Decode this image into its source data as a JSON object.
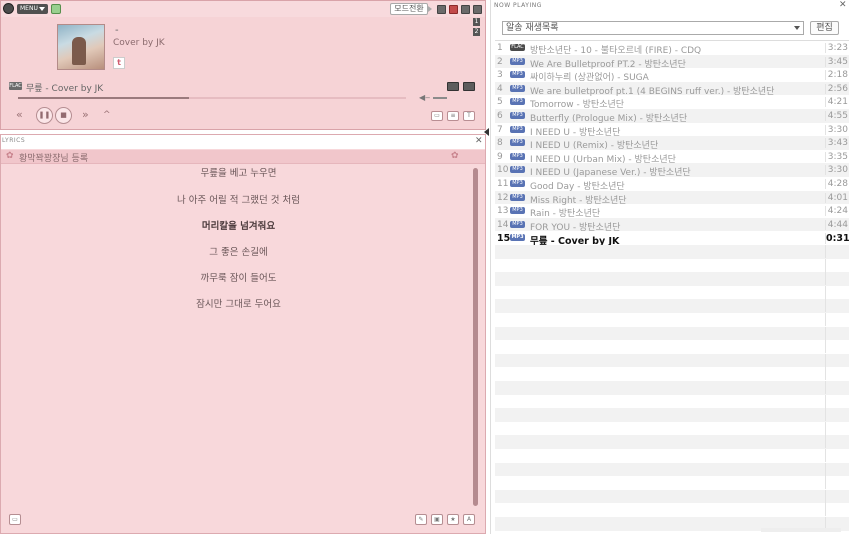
{
  "player": {
    "menu_label": "MENU",
    "mode_button": "모드전환",
    "song_title": "-",
    "song_artist": "Cover by JK",
    "sns_label": "t",
    "side_nums": [
      "1",
      "2"
    ],
    "format_badge": "FLAC",
    "now_playing_text": "무릎 - Cover by JK",
    "progress": 0.44,
    "controls": {
      "prev": "«",
      "pause": "❚❚",
      "stop": "■",
      "next": "»",
      "up": "^"
    }
  },
  "lyrics": {
    "header": "LYRICS",
    "credit": "황막꽉꽝쟝님 등록",
    "lines": [
      {
        "text": "무릎을 베고 누우면",
        "current": false
      },
      {
        "text": "나 아주 어릴 적 그랬던 것 처럼",
        "current": false
      },
      {
        "text": "머리칼을 넘겨줘요",
        "current": true
      },
      {
        "text": "그 좋은 손길에",
        "current": false
      },
      {
        "text": "까무룩 잠이 들어도",
        "current": false
      },
      {
        "text": "잠시만 그대로 두어요",
        "current": false
      }
    ]
  },
  "now_playing": {
    "header": "NOW PLAYING",
    "playlist_select": "알송 재생목록",
    "edit_label": "편집",
    "tracks": [
      {
        "no": "1",
        "badge": "FLAC",
        "title": "방탄소년단 - 10 - 불타오르네 (FIRE) - CDQ",
        "duration": "3:23"
      },
      {
        "no": "2",
        "badge": "MP3",
        "title": "We Are Bulletproof PT.2 - 방탄소년단",
        "duration": "3:45"
      },
      {
        "no": "3",
        "badge": "MP3",
        "title": "싸이하누릐 (상관없어) - SUGA",
        "duration": "2:18"
      },
      {
        "no": "4",
        "badge": "MP3",
        "title": "We are bulletproof pt.1 (4 BEGINS ruff ver.) - 방탄소년단",
        "duration": "2:56"
      },
      {
        "no": "5",
        "badge": "MP3",
        "title": "Tomorrow - 방탄소년단",
        "duration": "4:21"
      },
      {
        "no": "6",
        "badge": "MP3",
        "title": "Butterfly (Prologue Mix) - 방탄소년단",
        "duration": "4:55"
      },
      {
        "no": "7",
        "badge": "MP3",
        "title": "I NEED U - 방탄소년단",
        "duration": "3:30"
      },
      {
        "no": "8",
        "badge": "MP3",
        "title": "I NEED U (Remix) - 방탄소년단",
        "duration": "3:43"
      },
      {
        "no": "9",
        "badge": "MP3",
        "title": "I NEED U (Urban Mix) - 방탄소년단",
        "duration": "3:35"
      },
      {
        "no": "10",
        "badge": "MP3",
        "title": "I NEED U (Japanese Ver.) - 방탄소년단",
        "duration": "3:30"
      },
      {
        "no": "11",
        "badge": "MP3",
        "title": "Good Day - 방탄소년단",
        "duration": "4:28"
      },
      {
        "no": "12",
        "badge": "MP3",
        "title": "Miss Right - 방탄소년단",
        "duration": "4:01"
      },
      {
        "no": "13",
        "badge": "MP3",
        "title": "Rain - 방탄소년단",
        "duration": "4:24"
      },
      {
        "no": "14",
        "badge": "MP3",
        "title": "FOR YOU - 방탄소년단",
        "duration": "4:44"
      },
      {
        "no": "15",
        "badge": "MP3",
        "title": "무릎 - Cover by JK",
        "duration": "0:31",
        "playing": true
      }
    ]
  }
}
